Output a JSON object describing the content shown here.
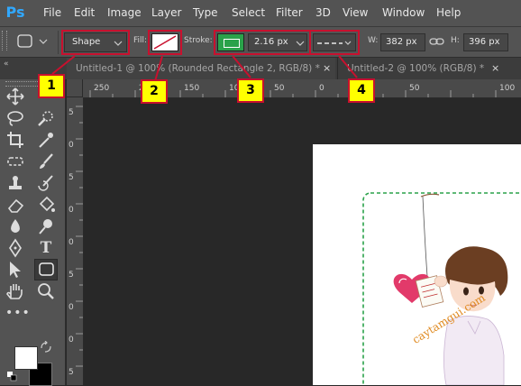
{
  "app": {
    "logo": "Ps"
  },
  "menu": [
    "File",
    "Edit",
    "Image",
    "Layer",
    "Type",
    "Select",
    "Filter",
    "3D",
    "View",
    "Window",
    "Help"
  ],
  "options": {
    "mode_value": "Shape",
    "fill_label": "Fill:",
    "stroke_label": "Stroke:",
    "stroke_width": "2.16 px",
    "w_label": "W:",
    "w_value": "382 px",
    "h_label": "H:",
    "h_value": "396 px"
  },
  "tabs": [
    {
      "label": "Untitled-1 @ 100% (Rounded Rectangle 2, RGB/8) *",
      "close": "×"
    },
    {
      "label": "Untitled-2 @ 100% (RGB/8) *",
      "close": "×"
    }
  ],
  "ruler": {
    "h_ticks": [
      "250",
      "200",
      "150",
      "100",
      "50",
      "0",
      "50",
      "100"
    ],
    "v_ticks": [
      "5",
      "0",
      "5",
      "0",
      "0",
      "5",
      "0",
      "0",
      "5"
    ]
  },
  "callouts": [
    "1",
    "2",
    "3",
    "4"
  ],
  "artwork": {
    "watermark": "caytamgui.com"
  },
  "colors": {
    "accent_red": "#c8102e",
    "stroke_green": "#2aa24a",
    "callout_yellow": "#ffff00"
  }
}
